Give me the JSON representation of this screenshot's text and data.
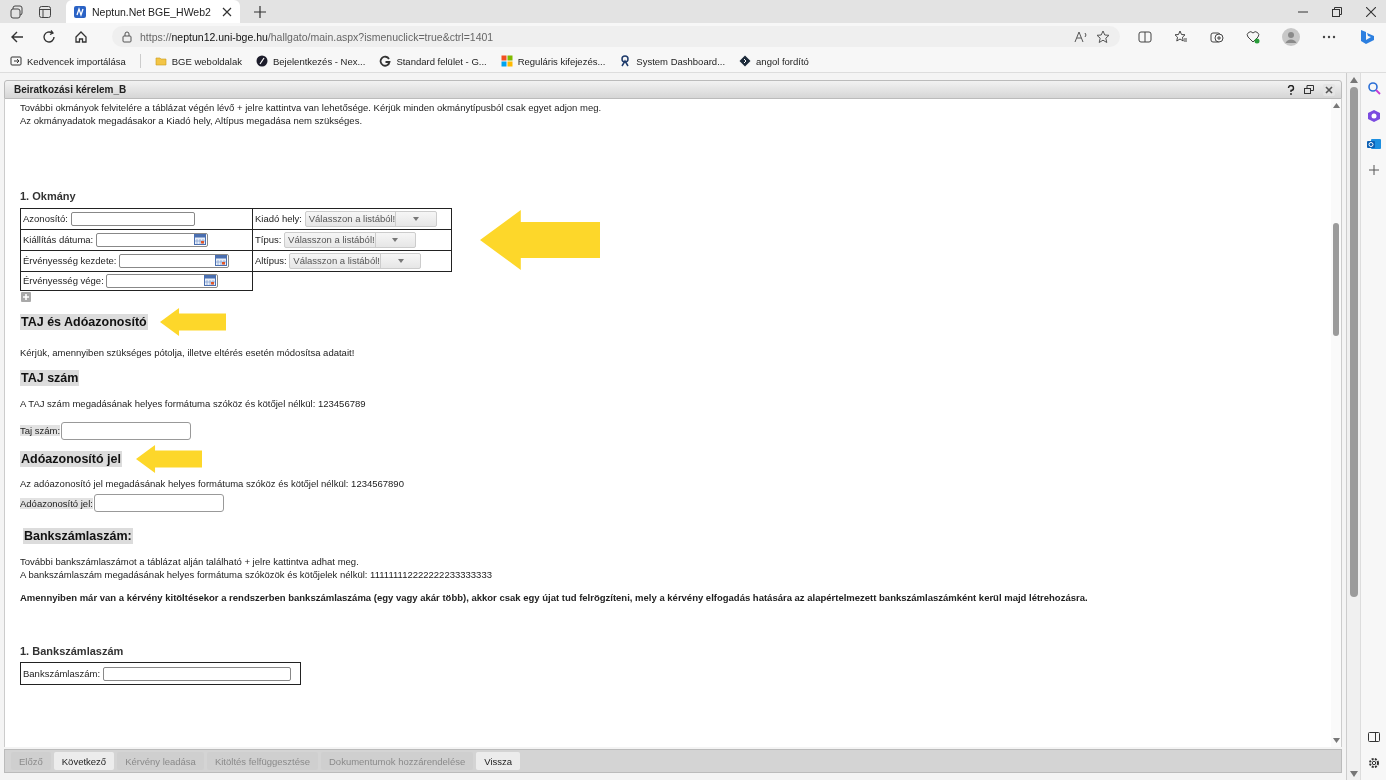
{
  "browser": {
    "tab_title": "Neptun.Net BGE_HWeb2",
    "url_host": "neptun12.uni-bge.hu",
    "url_scheme": "https://",
    "url_path": "/hallgato/main.aspx?ismenuclick=true&ctrl=1401",
    "bookmarks": [
      "Kedvencek importálása",
      "BGE weboldalak",
      "Bejelentkezés - Nex...",
      "Standard felület - G...",
      "Reguláris kifejezés...",
      "System Dashboard...",
      "angol fordító"
    ]
  },
  "dialog": {
    "title": "Beiratkozási kérelem_B",
    "intro": [
      "További okmányok felvitelére a táblázat végén lévő + jelre kattintva van lehetősége. Kérjük minden okmánytípusból csak egyet adjon meg.",
      "Az okmányadatok megadásakor a Kiadó hely, Altípus megadása nem szükséges."
    ],
    "document": {
      "heading": "1. Okmány",
      "left_fields": [
        {
          "label": "Azonosító:",
          "kind": "text"
        },
        {
          "label": "Kiállítás dátuma:",
          "kind": "date"
        },
        {
          "label": "Érvényesség kezdete:",
          "kind": "date"
        },
        {
          "label": "Érvényesség vége:",
          "kind": "date"
        }
      ],
      "right_fields": [
        {
          "label": "Kiadó hely:",
          "value": "Válasszon a listából!"
        },
        {
          "label": "Típus:",
          "value": "Válasszon a listából!"
        },
        {
          "label": "Altípus:",
          "value": "Válasszon a listából!"
        }
      ]
    },
    "ids": {
      "heading": "TAJ és Adóazonosító",
      "note": "Kérjük, amennyiben szükséges pótolja, illetve eltérés esetén módosítsa adatait!",
      "taj_heading": "TAJ szám",
      "taj_hint": "A TAJ szám megadásának helyes formátuma szóköz és kötőjel nélkül: 123456789",
      "taj_label": "Taj szám:",
      "tax_heading": "Adóazonosító jel",
      "tax_hint": "Az adóazonosító jel megadásának helyes formátuma szóköz és kötőjel nélkül: 1234567890",
      "tax_label": "Adóazonosító jel:"
    },
    "bank": {
      "heading": "Bankszámlaszám:",
      "hints": [
        "További bankszámlaszámot a táblázat alján található + jelre kattintva adhat meg.",
        "A bankszámlaszám megadásának helyes formátuma szóközök és kötőjelek nélkül: 111111112222222233333333"
      ],
      "warning": "Amennyiben már van a kérvény kitöltésekor a rendszerben bankszámlaszáma (egy vagy akár több), akkor csak egy újat tud felrögzíteni, mely a kérvény elfogadás hatására az alapértelmezett bankszámlaszámként kerül majd létrehozásra.",
      "subheading": "1. Bankszámlaszám",
      "label": "Bankszámlaszám:"
    },
    "footer_buttons": [
      {
        "label": "Előző",
        "disabled": true
      },
      {
        "label": "Következő",
        "disabled": false
      },
      {
        "label": "Kérvény leadása",
        "disabled": true
      },
      {
        "label": "Kitöltés felfüggesztése",
        "disabled": true
      },
      {
        "label": "Dokumentumok hozzárendelése",
        "disabled": true
      },
      {
        "label": "Vissza",
        "disabled": false
      }
    ]
  }
}
